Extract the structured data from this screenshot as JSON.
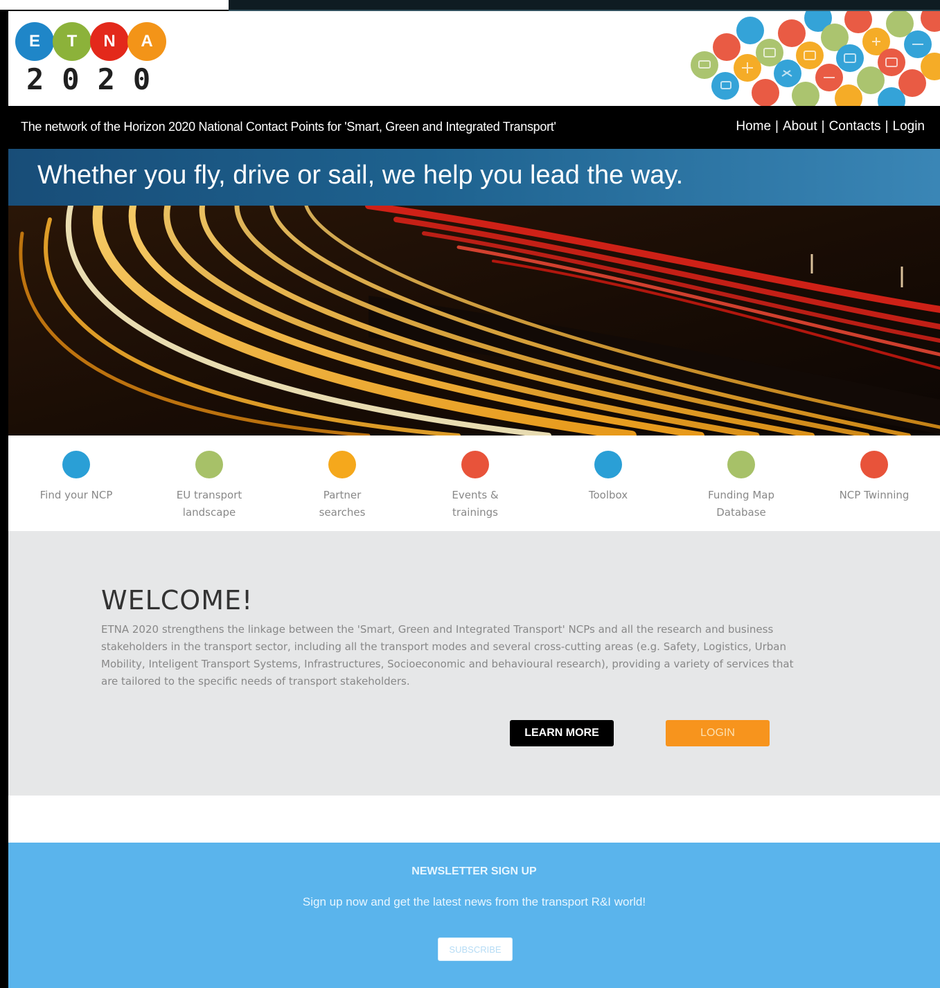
{
  "logo": {
    "letters": [
      "E",
      "T",
      "N",
      "A"
    ],
    "letter_colors": [
      "#1f86c8",
      "#8cb23a",
      "#e3291b",
      "#f39418"
    ],
    "year": "2020"
  },
  "nav": {
    "tagline": "The network of the Horizon 2020 National Contact Points for 'Smart, Green and Integrated Transport'",
    "links": [
      "Home",
      "About",
      "Contacts",
      "Login"
    ],
    "separator": "|"
  },
  "banner": {
    "slogan": "Whether you fly, drive or sail, we help you lead the way."
  },
  "services": [
    {
      "label": "Find your NCP",
      "color": "#2a9fd6",
      "icon": "blue-circle-icon"
    },
    {
      "label": "EU transport landscape",
      "color": "#a7c168",
      "icon": "green-circle-icon"
    },
    {
      "label": "Partner searches",
      "color": "#f5a81c",
      "icon": "orange-circle-icon"
    },
    {
      "label": "Events & trainings",
      "color": "#e8533a",
      "icon": "red-circle-icon"
    },
    {
      "label": "Toolbox",
      "color": "#2a9fd6",
      "icon": "blue-circle-icon"
    },
    {
      "label": "Funding Map Database",
      "color": "#a7c168",
      "icon": "green-circle-icon"
    },
    {
      "label": "NCP Twinning",
      "color": "#e8533a",
      "icon": "red-circle-icon"
    }
  ],
  "welcome": {
    "title": "WELCOME!",
    "body": "ETNA 2020 strengthens the linkage between the 'Smart, Green and Integrated Transport' NCPs and all the research and business stakeholders in the transport sector, including all the transport modes and several cross-cutting areas (e.g. Safety, Logistics, Urban Mobility, Inteligent Transport Systems, Infrastructures, Socioeconomic and behavioural research), providing a variety of services that are tailored to the specific needs of transport stakeholders.",
    "learn_more": "LEARN MORE",
    "login": "LOGIN"
  },
  "newsletter": {
    "title": "NEWSLETTER SIGN UP",
    "subtitle": "Sign up now and get the latest news from the transport R&I world!",
    "button": "SUBSCRIBE"
  },
  "colors": {
    "nav_bg": "#000000",
    "banner_blue": "#1e628f",
    "welcome_bg": "#e6e7e8",
    "newsletter_bg": "#5ab4ec",
    "login_orange": "#f7941d"
  }
}
